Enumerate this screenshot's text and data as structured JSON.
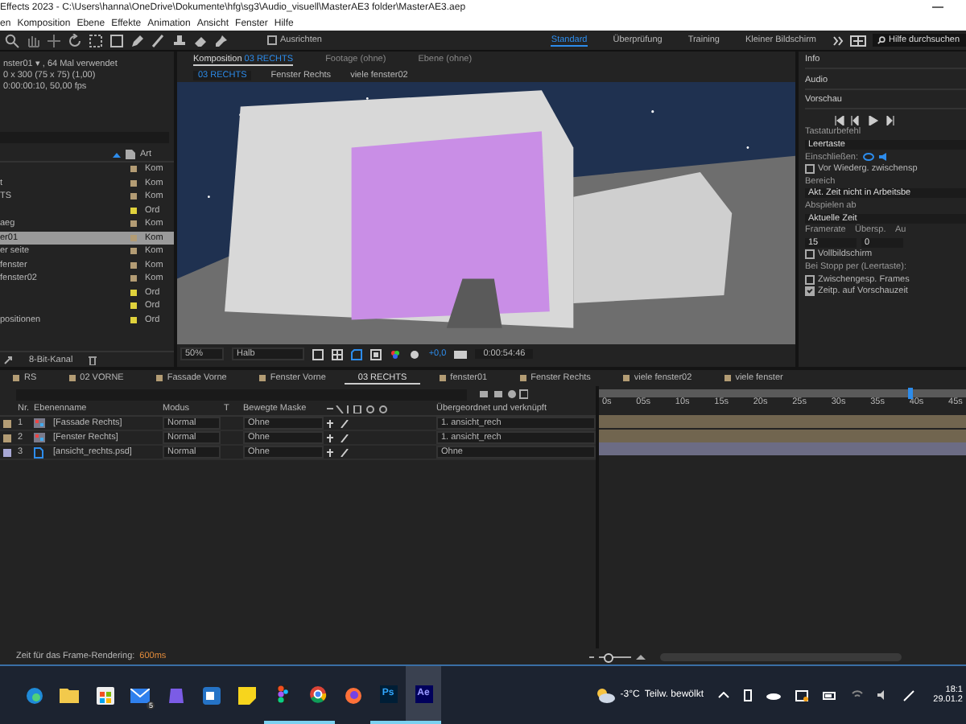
{
  "title_bar": {
    "title": "Effects 2023 - C:\\Users\\hanna\\OneDrive\\Dokumente\\hfg\\sg3\\Audio_visuell\\MasterAE3 folder\\MasterAE3.aep"
  },
  "menu": [
    "en",
    "Komposition",
    "Ebene",
    "Effekte",
    "Animation",
    "Ansicht",
    "Fenster",
    "Hilfe"
  ],
  "toolbar": {
    "align": {
      "label": "Ausrichten",
      "checked": false
    },
    "workspaces": [
      {
        "label": "Standard",
        "selected": true
      },
      {
        "label": "Überprüfung",
        "selected": false
      },
      {
        "label": "Training",
        "selected": false
      },
      {
        "label": "Kleiner Bildschirm",
        "selected": false
      }
    ],
    "search": {
      "placeholder": "Hilfe durchsuchen"
    }
  },
  "project": {
    "info": [
      "nster01 ▾ , 64 Mal verwendet",
      "0 x 300 (75 x 75) (1,00)",
      "0:00:00:10, 50,00 fps"
    ],
    "column": "Art",
    "items": [
      {
        "type": "Kom",
        "color": "#b39c74",
        "selected": false
      },
      {
        "name": "t",
        "type": "Kom",
        "color": "#b39c74",
        "selected": false
      },
      {
        "name": "TS",
        "type": "Kom",
        "color": "#b39c74",
        "selected": false
      },
      {
        "type": "Ord",
        "color": "#e0d23c",
        "selected": false
      },
      {
        "name": "aeg",
        "type": "Kom",
        "color": "#b39c74",
        "selected": false
      },
      {
        "name": "er01",
        "type": "Kom",
        "color": "#b39c74",
        "selected": true
      },
      {
        "name": "er seite",
        "type": "Kom",
        "color": "#b39c74",
        "selected": false
      },
      {
        "name": "fenster",
        "type": "Kom",
        "color": "#b39c74",
        "selected": false
      },
      {
        "name": "fenster02",
        "type": "Kom",
        "color": "#b39c74",
        "selected": false
      },
      {
        "type": "Ord",
        "color": "#e0d23c",
        "selected": false
      },
      {
        "type": "Ord",
        "color": "#e0d23c",
        "selected": false
      },
      {
        "name": "positionen",
        "type": "Ord",
        "color": "#e0d23c",
        "selected": false
      }
    ],
    "footer": "8-Bit-Kanal"
  },
  "composition": {
    "tabs": [
      {
        "label": "Komposition",
        "value": "03 RECHTS",
        "selected": true
      },
      {
        "label": "Footage",
        "value": "(ohne)",
        "selected": false
      },
      {
        "label": "Ebene",
        "value": "(ohne)",
        "selected": false
      }
    ],
    "breadcrumbs": [
      {
        "label": "03 RECHTS",
        "selected": true
      },
      {
        "label": "Fenster Rechts",
        "selected": false
      },
      {
        "label": "viele fenster02",
        "selected": false
      }
    ],
    "zoom": "50%",
    "resolution": "Halb",
    "exposure": "+0,0",
    "timecode": "0:00:54:46"
  },
  "right_panel": {
    "sections": [
      "Info",
      "Audio"
    ],
    "preview": {
      "title": "Vorschau",
      "shortcut_label": "Tastaturbefehl",
      "shortcut": "Leertaste",
      "include_label": "Einschließen:",
      "cache_before": {
        "label": "Vor Wiederg. zwischensp",
        "checked": false
      },
      "range_label": "Bereich",
      "range": "Akt. Zeit nicht in Arbeitsbe",
      "play_from_label": "Abspielen ab",
      "play_from": "Aktuelle Zeit",
      "framerate_label": "Framerate",
      "skip_label": "Übersp.",
      "resolution_label": "Au",
      "framerate": "15",
      "skip": "0",
      "fullscreen": {
        "label": "Vollbildschirm",
        "checked": false
      },
      "on_stop_label": "Bei Stopp per (Leertaste):",
      "stop_options": [
        {
          "label": "Zwischengesp. Frames",
          "checked": false
        },
        {
          "label": "Zeitp. auf Vorschauzeit",
          "checked": true
        }
      ]
    }
  },
  "timeline": {
    "tabs": [
      {
        "label": "RS",
        "selected": false
      },
      {
        "label": "02 VORNE",
        "selected": false
      },
      {
        "label": "Fassade Vorne",
        "selected": false
      },
      {
        "label": "Fenster Vorne",
        "selected": false
      },
      {
        "label": "03 RECHTS",
        "selected": true
      },
      {
        "label": "fenster01",
        "selected": false
      },
      {
        "label": "Fenster Rechts",
        "selected": false
      },
      {
        "label": "viele fenster02",
        "selected": false
      },
      {
        "label": "viele fenster",
        "selected": false
      }
    ],
    "columns": {
      "number": "Nr.",
      "name": "Ebenenname",
      "mode": "Modus",
      "track": "T",
      "matte": "Bewegte Maske",
      "parent": "Übergeordnet und verknüpft"
    },
    "layers": [
      {
        "number": "1",
        "name": "[Fassade Rechts]",
        "kind": "comp",
        "color": "#b39c74",
        "mode": "Normal",
        "matte": "Ohne",
        "parent": "1. ansicht_rech"
      },
      {
        "number": "2",
        "name": "[Fenster Rechts]",
        "kind": "comp",
        "color": "#b39c74",
        "mode": "Normal",
        "matte": "Ohne",
        "parent": "1. ansicht_rech"
      },
      {
        "number": "3",
        "name": "[ansicht_rechts.psd]",
        "kind": "file",
        "color": "#a9a9d6",
        "mode": "Normal",
        "matte": "Ohne",
        "parent": "Ohne"
      }
    ],
    "ruler": [
      "0s",
      "05s",
      "10s",
      "15s",
      "20s",
      "25s",
      "30s",
      "35s",
      "40s",
      "45s"
    ],
    "playhead": {
      "level": 0.84
    }
  },
  "status_bar": {
    "label": "Zeit für das Frame-Rendering:",
    "value": "600ms",
    "zoom_slider": {
      "level": 0.25
    }
  },
  "taskbar": {
    "apps": [
      {
        "kind": "edge",
        "running": false,
        "selected": false
      },
      {
        "kind": "folder",
        "running": false,
        "selected": false
      },
      {
        "kind": "store",
        "running": false,
        "selected": false
      },
      {
        "kind": "mail",
        "badge": "5",
        "running": false,
        "selected": false
      },
      {
        "kind": "copilot",
        "running": false,
        "selected": false
      },
      {
        "kind": "outlook",
        "running": false,
        "selected": false
      },
      {
        "kind": "notes",
        "running": false,
        "selected": false
      },
      {
        "kind": "figma",
        "running": true,
        "selected": false
      },
      {
        "kind": "chrome",
        "running": true,
        "selected": false
      },
      {
        "kind": "firefox",
        "running": false,
        "selected": false
      },
      {
        "kind": "badge",
        "label": "Ps",
        "running": true,
        "selected": false
      },
      {
        "kind": "badge",
        "label": "Ae",
        "running": true,
        "selected": true
      }
    ],
    "weather": {
      "temperature": "-3°C",
      "condition": "Teilw. bewölkt"
    },
    "clock": {
      "time": "18:1",
      "date": "29.01.2"
    }
  }
}
